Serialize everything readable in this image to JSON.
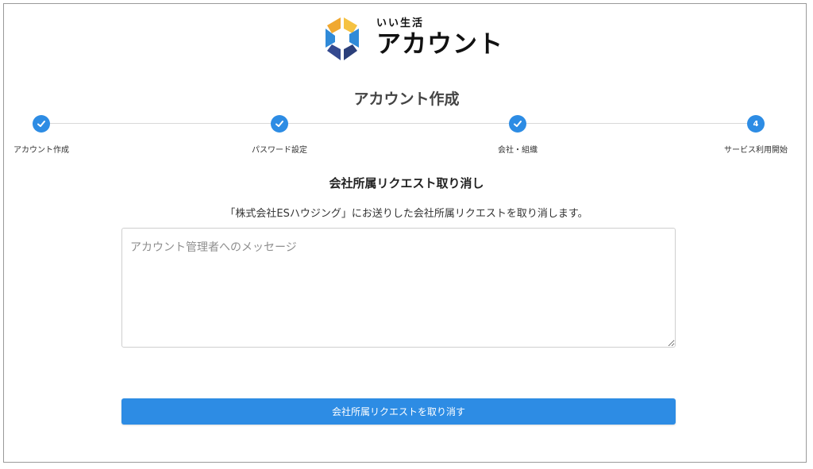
{
  "logo": {
    "sub_text": "いい生活",
    "main_text": "アカウント"
  },
  "page_title": "アカウント作成",
  "stepper": {
    "steps": [
      {
        "label": "アカウント作成",
        "status": "complete",
        "icon": "check-icon",
        "number": ""
      },
      {
        "label": "パスワード設定",
        "status": "complete",
        "icon": "check-icon",
        "number": ""
      },
      {
        "label": "会社・組織",
        "status": "complete",
        "icon": "check-icon",
        "number": ""
      },
      {
        "label": "サービス利用開始",
        "status": "current",
        "icon": "",
        "number": "4"
      }
    ]
  },
  "main": {
    "section_title": "会社所属リクエスト取り消し",
    "description": "「株式会社ESハウジング」にお送りした会社所属リクエストを取り消します。",
    "message_field": {
      "value": "",
      "placeholder": "アカウント管理者へのメッセージ"
    },
    "submit_label": "会社所属リクエストを取り消す"
  },
  "colors": {
    "accent": "#2d8ce4",
    "logo_orange": "#f0a830",
    "logo_blue": "#2f8ad8",
    "logo_navy": "#2b3f7a"
  }
}
